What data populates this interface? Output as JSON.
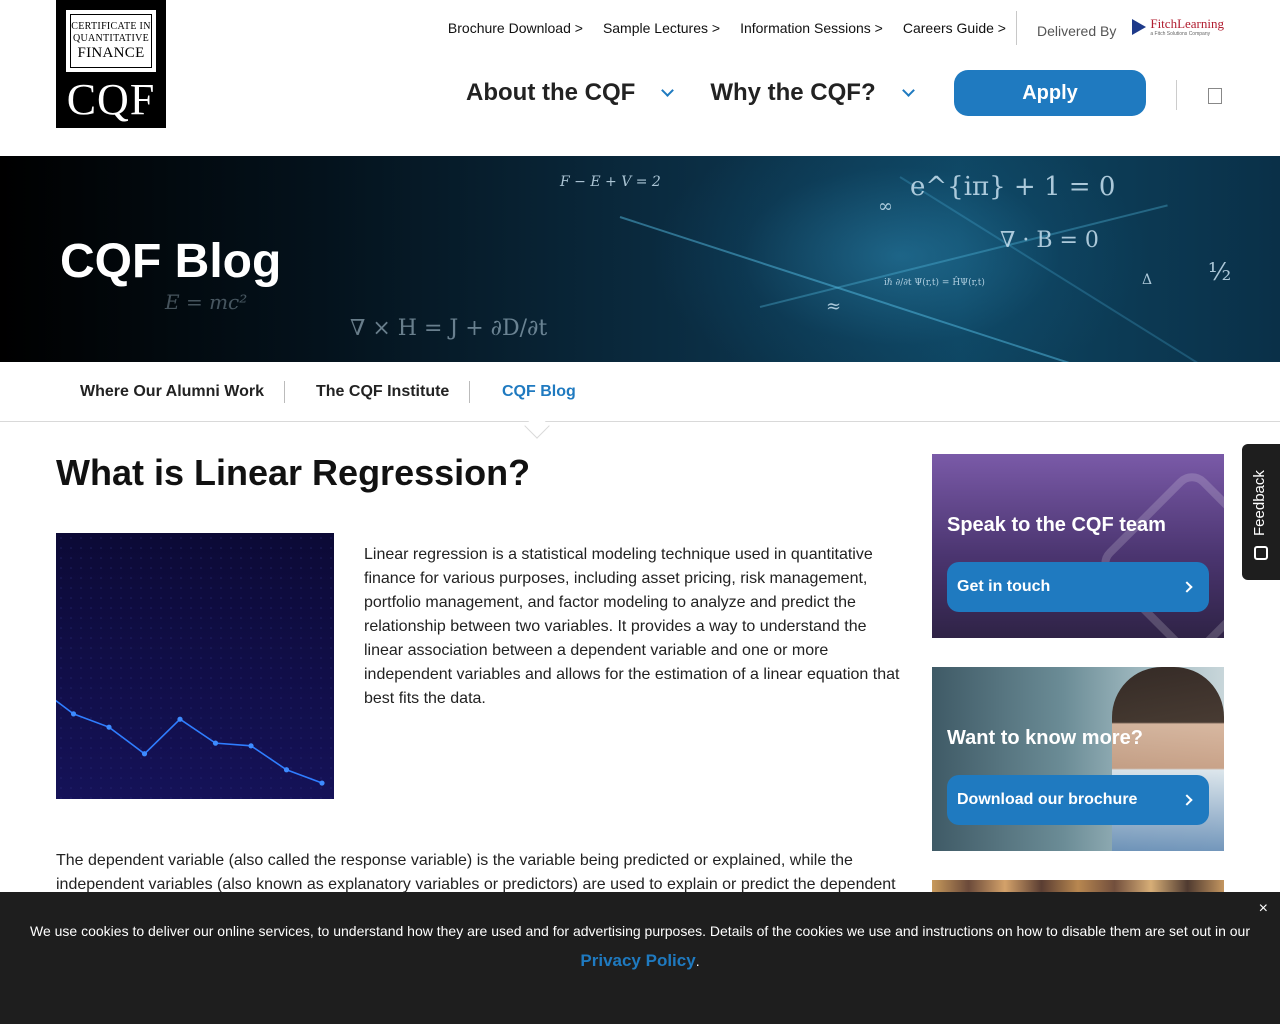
{
  "logo": {
    "line1": "CERTIFICATE IN",
    "line2": "QUANTITATIVE",
    "line3": "FINANCE",
    "mark": "CQF"
  },
  "utility_nav": {
    "links": [
      "Brochure Download >",
      "Sample Lectures >",
      "Information Sessions >",
      "Careers Guide >"
    ],
    "delivered_by": "Delivered By",
    "partner_name": "FitchLearning",
    "partner_sub": "a Fitch Solutions Company"
  },
  "main_nav": {
    "items": [
      "About the CQF",
      "Why the CQF?"
    ],
    "apply_label": "Apply"
  },
  "hero": {
    "title": "CQF Blog",
    "equations": [
      "F − E + V = 2",
      "e^{iπ} + 1 = 0",
      "∇ · B = 0",
      "E = mc²",
      "∇ × H = J + ∂D/∂t",
      "½",
      "∞",
      "Δ",
      "≈",
      "iℏ ∂/∂t Ψ(r,t) = ĤΨ(r,t)"
    ]
  },
  "subnav": {
    "items": [
      "Where Our Alumni Work",
      "The CQF Institute",
      "CQF Blog"
    ],
    "active": "CQF Blog"
  },
  "article": {
    "title": "What is Linear Regression?",
    "intro": "Linear regression is a statistical modeling technique used in quantitative finance for various purposes, including asset pricing, risk management, portfolio management, and factor modeling to analyze and predict the relationship between two variables. It provides a way to understand the linear association between a dependent variable and one or more independent variables and allows for the estimation of a linear equation that best fits the data.",
    "para2": "The dependent variable (also called the response variable) is the variable being predicted or explained, while the independent variables (also known as explanatory variables or predictors) are used to explain or predict the dependent",
    "image_line_values": [
      0.42,
      0.32,
      0.27,
      0.17,
      0.3,
      0.21,
      0.2,
      0.11,
      0.06
    ]
  },
  "sidebar": {
    "card1": {
      "title": "Speak to the CQF team",
      "button": "Get in touch"
    },
    "card2": {
      "title": "Want to know more?",
      "button": "Download our brochure"
    }
  },
  "feedback": {
    "label": "Feedback"
  },
  "cookie": {
    "text": "We use cookies to deliver our online services, to understand how they are used and for advertising purposes. Details of the cookies we use and instructions on how to disable them are set out in our ",
    "link": "Privacy Policy",
    "suffix": ".",
    "close": "×"
  },
  "colors": {
    "brand_blue": "#1f7ac0",
    "dark_banner": "#1e1e1e"
  }
}
